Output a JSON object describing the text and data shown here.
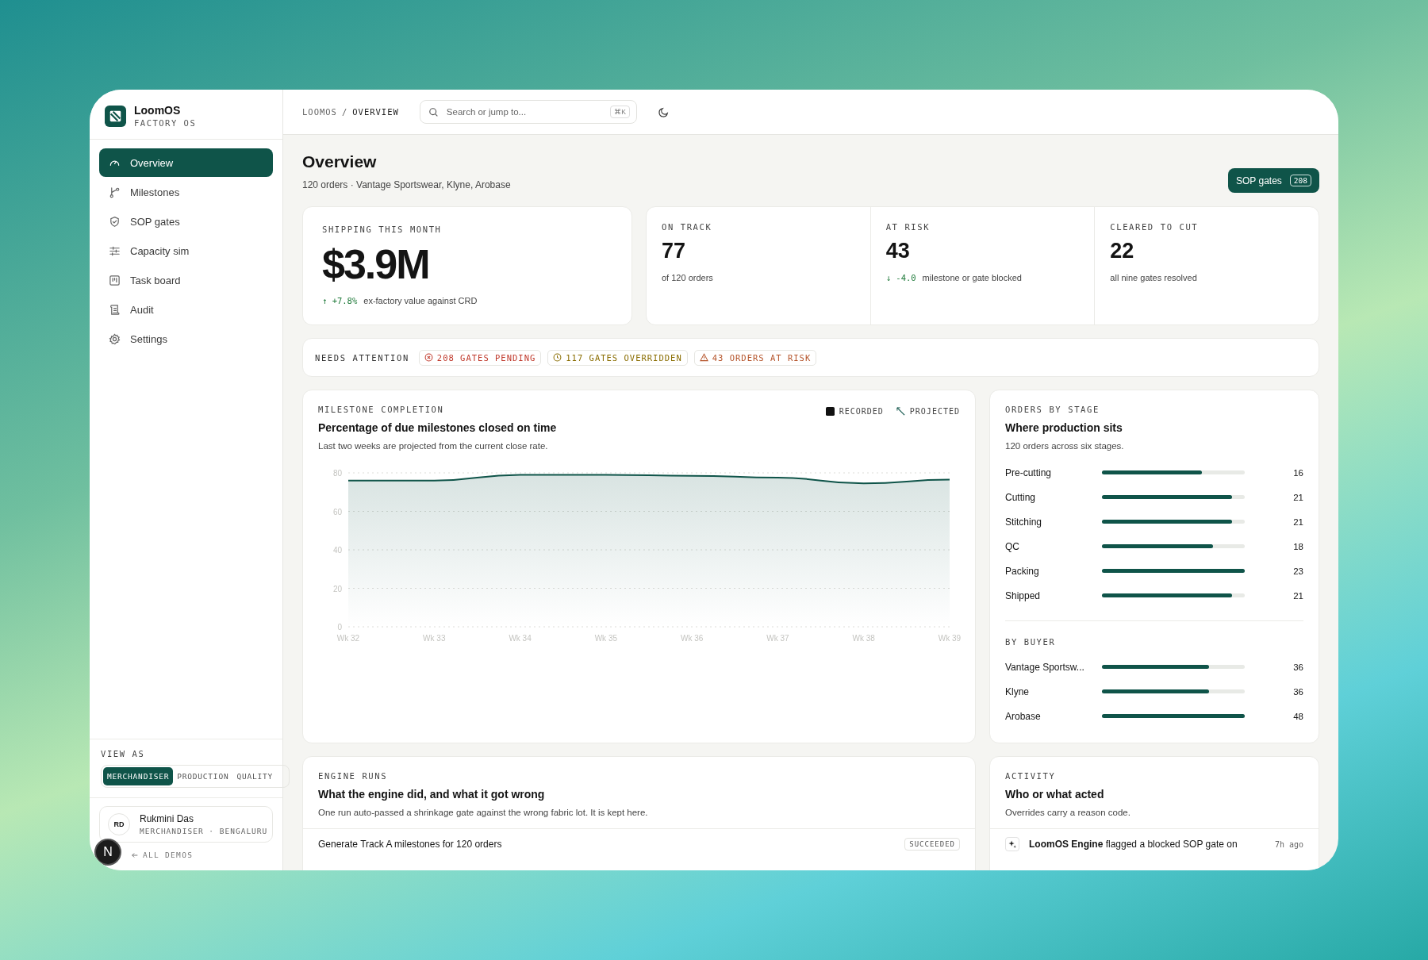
{
  "brand": {
    "name": "LoomOS",
    "subtitle": "FACTORY OS"
  },
  "nav": [
    {
      "label": "Overview",
      "selected": true
    },
    {
      "label": "Milestones",
      "selected": false
    },
    {
      "label": "SOP gates",
      "selected": false
    },
    {
      "label": "Capacity sim",
      "selected": false
    },
    {
      "label": "Task board",
      "selected": false
    },
    {
      "label": "Audit",
      "selected": false
    },
    {
      "label": "Settings",
      "selected": false
    }
  ],
  "view_as": {
    "label": "VIEW AS",
    "options": [
      {
        "label": "MERCHANDISER",
        "selected": true
      },
      {
        "label": "PRODUCTION",
        "selected": false
      },
      {
        "label": "QUALITY",
        "selected": false
      }
    ]
  },
  "user": {
    "initials": "RD",
    "name": "Rukmini Das",
    "role": "MERCHANDISER · BENGALURU"
  },
  "back_link": "ALL DEMOS",
  "dev_badge": "N",
  "breadcrumb": {
    "items": [
      "LOOMOS",
      "OVERVIEW"
    ],
    "separator": "/"
  },
  "search": {
    "placeholder": "Search or jump to...",
    "shortcut": "⌘K"
  },
  "page": {
    "title": "Overview",
    "subtitle": "120 orders · Vantage Sportswear, Klyne, Arobase",
    "action": {
      "label": "SOP gates",
      "count": "208"
    }
  },
  "hero_kpi": {
    "label": "SHIPPING THIS MONTH",
    "value": "$3.9M",
    "delta": "↑ +7.8%",
    "note": "ex-factory value against CRD"
  },
  "kpis": [
    {
      "label": "ON TRACK",
      "value": "77",
      "note": "of 120 orders"
    },
    {
      "label": "AT RISK",
      "value": "43",
      "delta": "↓ -4.0",
      "note": "milestone or gate blocked"
    },
    {
      "label": "CLEARED TO CUT",
      "value": "22",
      "note": "all nine gates resolved"
    }
  ],
  "attention": {
    "label": "NEEDS ATTENTION",
    "items": [
      {
        "text": "208 GATES PENDING",
        "kind": "pending"
      },
      {
        "text": "117 GATES OVERRIDDEN",
        "kind": "overridden"
      },
      {
        "text": "43 ORDERS AT RISK",
        "kind": "risk"
      }
    ]
  },
  "milestones": {
    "eyebrow": "MILESTONE COMPLETION",
    "title": "Percentage of due milestones closed on time",
    "description": "Last two weeks are projected from the current close rate.",
    "legend": [
      {
        "label": "PROJECTED",
        "kind": "hatched"
      }
    ],
    "chart_data": {
      "type": "line",
      "categories": [
        "Wk 32",
        "Wk 33",
        "Wk 34",
        "Wk 35",
        "Wk 36",
        "Wk 37",
        "Wk 38",
        "Wk 39"
      ],
      "ylim": [
        0,
        80
      ],
      "grid": true,
      "yticks": [
        0,
        20,
        40,
        60,
        80
      ],
      "series": [
        {
          "name": "RECORDED",
          "color": "#0f5449",
          "values": [
            76,
            76,
            79,
            79,
            78.5,
            77.5,
            74.5,
            76.5
          ]
        }
      ]
    }
  },
  "stages": {
    "eyebrow": "ORDERS BY STAGE",
    "title": "Where production sits",
    "description": "120 orders across six stages.",
    "rows": [
      {
        "label": "Pre-cutting",
        "value": "16",
        "level": 0.7
      },
      {
        "label": "Cutting",
        "value": "21",
        "level": 0.91
      },
      {
        "label": "Stitching",
        "value": "21",
        "level": 0.91
      },
      {
        "label": "QC",
        "value": "18",
        "level": 0.78
      },
      {
        "label": "Packing",
        "value": "23",
        "level": 1
      },
      {
        "label": "Shipped",
        "value": "21",
        "level": 0.91
      }
    ],
    "buyer_label": "BY BUYER",
    "buyers": [
      {
        "label": "Vantage Sportsw...",
        "value": "36",
        "level": 0.75
      },
      {
        "label": "Klyne",
        "value": "36",
        "level": 0.75
      },
      {
        "label": "Arobase",
        "value": "48",
        "level": 1
      }
    ]
  },
  "engine_runs": {
    "eyebrow": "ENGINE RUNS",
    "title": "What the engine did, and what it got wrong",
    "description": "One run auto-passed a shrinkage gate against the wrong fabric lot. It is kept here.",
    "runs": [
      {
        "title": "Generate Track A milestones for 120 orders",
        "status": "SUCCEEDED"
      }
    ]
  },
  "activity": {
    "eyebrow": "ACTIVITY",
    "title": "Who or what acted",
    "description": "Overrides carry a reason code.",
    "items": [
      {
        "text": "**LoomOS Engine** flagged a blocked SOP gate on",
        "time": "7h ago"
      }
    ]
  }
}
